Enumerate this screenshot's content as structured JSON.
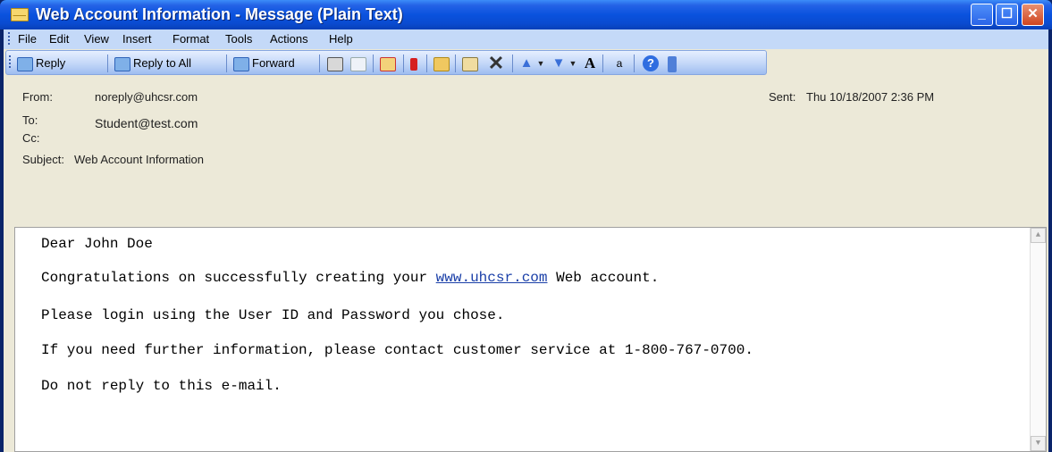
{
  "window": {
    "title": "Web Account Information - Message (Plain Text)",
    "minimize_glyph": "_",
    "maximize_glyph": "☐",
    "close_glyph": "✕"
  },
  "menu": [
    "File",
    "Edit",
    "View",
    "Insert",
    "Format",
    "Tools",
    "Actions",
    "Help"
  ],
  "toolbar": {
    "reply": "Reply",
    "reply_all": "Reply to All",
    "forward": "Forward",
    "font_size_glyph": "A",
    "help_glyph": "?"
  },
  "header": {
    "from_label": "From:",
    "from_value": "noreply@uhcsr.com",
    "sent_label": "Sent:",
    "sent_value": "Thu 10/18/2007 2:36 PM",
    "to_label": "To:",
    "to_value": "Student@test.com",
    "cc_label": "Cc:",
    "subject_label": "Subject:",
    "subject_value": "Web Account Information"
  },
  "body": {
    "greeting": "Dear John Doe",
    "line1_pre": "Congratulations on successfully creating your ",
    "line1_link": "www.uhcsr.com",
    "line1_post": " Web account.",
    "line2": "Please login using the User ID and Password you chose.",
    "line3": "If you need further information, please contact customer service at 1-800-767-0700.",
    "line4": "Do not reply to this e-mail."
  },
  "colors": {
    "titlebar": "#0a52de",
    "menubar": "#c4d9f8",
    "header_bg": "#ece9d8",
    "link": "#1a3fa8"
  },
  "icons": [
    "envelope-icon",
    "reply-icon",
    "reply-all-icon",
    "forward-icon",
    "print-icon",
    "copy-icon",
    "delete-message-icon",
    "flag-icon",
    "move-folder-icon",
    "categorize-icon",
    "delete-icon",
    "previous-item-icon",
    "next-item-icon",
    "font-size-icon",
    "translate-icon",
    "help-icon",
    "toolbar-options-icon"
  ]
}
